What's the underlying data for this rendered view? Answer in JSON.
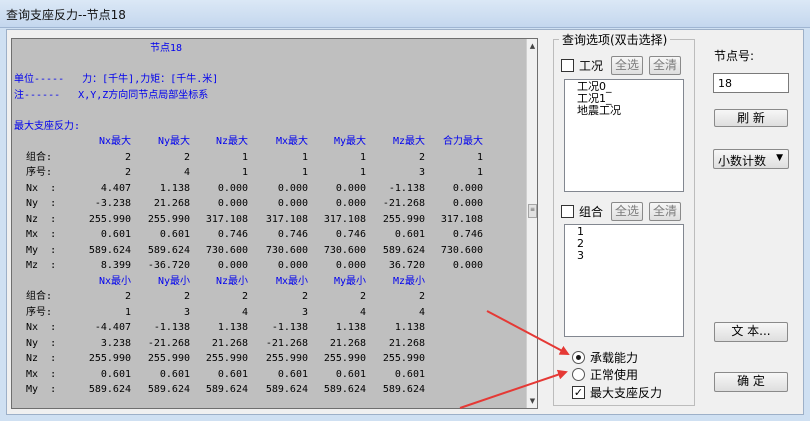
{
  "window": {
    "title": "查询支座反力--节点18"
  },
  "report": {
    "heading": "节点18",
    "unit_line": "单位-----   力：[千牛],力矩：[千牛.米]",
    "note_line": "注------   X,Y,Z方向同节点局部坐标系",
    "section_title": "最大支座反力:",
    "max_headers": [
      "Nx最大",
      "Ny最大",
      "Nz最大",
      "Mx最大",
      "My最大",
      "Mz最大",
      "合力最大"
    ],
    "max_combo": {
      "label": "组合:",
      "values": [
        "2",
        "2",
        "1",
        "1",
        "1",
        "2",
        "1"
      ]
    },
    "max_index": {
      "label": "序号:",
      "values": [
        "2",
        "4",
        "1",
        "1",
        "1",
        "3",
        "1"
      ]
    },
    "max_rows": [
      {
        "label": "Nx  :",
        "values": [
          "4.407",
          "1.138",
          "0.000",
          "0.000",
          "0.000",
          "-1.138",
          "0.000"
        ]
      },
      {
        "label": "Ny  :",
        "values": [
          "-3.238",
          "21.268",
          "0.000",
          "0.000",
          "0.000",
          "-21.268",
          "0.000"
        ]
      },
      {
        "label": "Nz  :",
        "values": [
          "255.990",
          "255.990",
          "317.108",
          "317.108",
          "317.108",
          "255.990",
          "317.108"
        ]
      },
      {
        "label": "Mx  :",
        "values": [
          "0.601",
          "0.601",
          "0.746",
          "0.746",
          "0.746",
          "0.601",
          "0.746"
        ]
      },
      {
        "label": "My  :",
        "values": [
          "589.624",
          "589.624",
          "730.600",
          "730.600",
          "730.600",
          "589.624",
          "730.600"
        ]
      },
      {
        "label": "Mz  :",
        "values": [
          "8.399",
          "-36.720",
          "0.000",
          "0.000",
          "0.000",
          "36.720",
          "0.000"
        ]
      }
    ],
    "min_headers": [
      "Nx最小",
      "Ny最小",
      "Nz最小",
      "Mx最小",
      "My最小",
      "Mz最小"
    ],
    "min_combo": {
      "label": "组合:",
      "values": [
        "2",
        "2",
        "2",
        "2",
        "2",
        "2"
      ]
    },
    "min_index": {
      "label": "序号:",
      "values": [
        "1",
        "3",
        "4",
        "3",
        "4",
        "4"
      ]
    },
    "min_rows": [
      {
        "label": "Nx  :",
        "values": [
          "-4.407",
          "-1.138",
          "1.138",
          "-1.138",
          "1.138",
          "1.138"
        ]
      },
      {
        "label": "Ny  :",
        "values": [
          "3.238",
          "-21.268",
          "21.268",
          "-21.268",
          "21.268",
          "21.268"
        ]
      },
      {
        "label": "Nz  :",
        "values": [
          "255.990",
          "255.990",
          "255.990",
          "255.990",
          "255.990",
          "255.990"
        ]
      },
      {
        "label": "Mx  :",
        "values": [
          "0.601",
          "0.601",
          "0.601",
          "0.601",
          "0.601",
          "0.601"
        ]
      },
      {
        "label": "My  :",
        "values": [
          "589.624",
          "589.624",
          "589.624",
          "589.624",
          "589.624",
          "589.624"
        ]
      }
    ]
  },
  "options": {
    "group_title": "查询选项(双击选择)",
    "cases": {
      "label": "工况",
      "checked": false,
      "select_all": "全选",
      "clear_all": "全清",
      "items": [
        "工况0_",
        "工况1_",
        "地震工况"
      ]
    },
    "combos": {
      "label": "组合",
      "checked": false,
      "select_all": "全选",
      "clear_all": "全清",
      "items": [
        "1",
        "2",
        "3"
      ]
    },
    "radios": [
      {
        "label": "承载能力",
        "selected": true
      },
      {
        "label": "正常使用",
        "selected": false
      }
    ],
    "max_reaction": {
      "label": "最大支座反力",
      "checked": true
    }
  },
  "right_panel": {
    "node_label": "节点号:",
    "node_value": "18",
    "refresh_label": "刷  新",
    "decimal_select": "小数计数",
    "text_button": "文  本...",
    "ok_button": "确  定"
  },
  "icons": {
    "checkmark": "checkmark-icon",
    "dropdown": "chevron-down-icon",
    "scroll_up": "scroll-up-icon",
    "scroll_down": "scroll-down-icon"
  },
  "colors": {
    "report_bg": "#bfbfbf",
    "header_blue": "#0000ee",
    "annotation_red": "#e53935"
  }
}
